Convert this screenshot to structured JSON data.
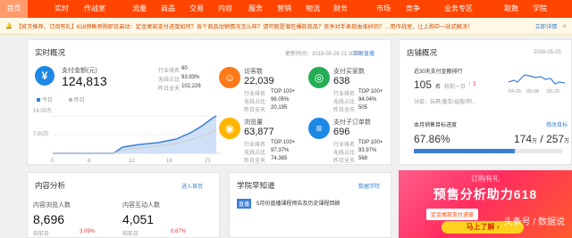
{
  "nav": {
    "items": [
      "首页",
      "实时",
      "作战室",
      "流量",
      "商品",
      "交易",
      "内容",
      "服务",
      "营销",
      "物流",
      "财务",
      "市场",
      "竞争",
      "业务专区",
      "取数",
      "学院"
    ],
    "active_index": 0
  },
  "notice": {
    "text": "【官方推荐，订阅有礼】618预售预购即日启动：定金尾款支付进度如何？各个商品动销情况怎么样？请可能是潜在爆款商品？竞争对手表现由谁好的？…用作战室，让上购中一站式解决！",
    "link_text": "立即详情",
    "close_icon": "×"
  },
  "realtime": {
    "title": "实时概况",
    "update_time": "更新时间：2018-05-26 21:30:05",
    "link": "实时直播",
    "payment_label": "支付金额(元)",
    "payment_value": "124,813",
    "rank_label": "行业排名",
    "rank_value": "60",
    "wireless_label": "无线占比",
    "wireless_value": "93.93%",
    "yesterday_label": "昨日全天",
    "yesterday_value": "102,226",
    "legend_today": "今日",
    "legend_yesterday": "昨日",
    "y_axis_top": "14.00万",
    "y_axis_mid": "7.00万",
    "x_axis": [
      "0",
      "6",
      "12",
      "18",
      "23"
    ],
    "cards": [
      {
        "label": "访客数",
        "value": "22,039",
        "rank_label": "行业排名",
        "rank": "TOP 100+",
        "wireless_label": "无线占比",
        "wireless": "96.05%",
        "yesterday_label": "昨日全天",
        "yesterday": "20,195",
        "icon": "user-icon",
        "color": "#ff7a1a"
      },
      {
        "label": "支付买家数",
        "value": "638",
        "rank_label": "行业排名",
        "rank": "TOP 100+",
        "wireless_label": "无线占比",
        "wireless": "94.04%",
        "yesterday_label": "昨日全天",
        "yesterday": "505",
        "icon": "buyer-icon",
        "color": "#23ad54"
      },
      {
        "label": "浏览量",
        "value": "63,877",
        "rank_label": "行业排名",
        "rank": "TOP 100+",
        "wireless_label": "无线占比",
        "wireless": "97.37%",
        "yesterday_label": "昨日全天",
        "yesterday": "74,385",
        "icon": "eye-icon",
        "color": "#ffb400"
      },
      {
        "label": "支付子订单数",
        "value": "696",
        "rank_label": "行业排名",
        "rank": "TOP 100+",
        "wireless_label": "无线占比",
        "wireless": "93.97%",
        "yesterday_label": "昨日全天",
        "yesterday": "568",
        "icon": "order-icon",
        "color": "#1e88e5"
      }
    ]
  },
  "store": {
    "title": "店铺概况",
    "date": "2018-05-25",
    "rank_title": "近30天支付金额排行",
    "rank_value": "105",
    "rank_unit": "名",
    "rank_change": "较前一日",
    "change_icon": "↑",
    "change_value": "3",
    "category": "分层：玩具/童车/益智/积...",
    "chart_dates": [
      "04-26",
      "05-08",
      "05-25"
    ],
    "target_title": "本月销售目标进度",
    "target_link": "修改目标",
    "progress": "67.86%",
    "progress_fraction": 0.6786,
    "amount_value": "174",
    "amount_unit": "万",
    "target_sep": "/",
    "target_value": "257",
    "target_unit": "万"
  },
  "content": {
    "title": "内容分析",
    "link": "进入首页",
    "browse_label": "内容浏览人数",
    "browse_value": "8,696",
    "interact_label": "内容互动人数",
    "interact_value": "4,051",
    "browse_compare": "较前日",
    "browse_delta": "3.09%",
    "interact_compare": "较前日",
    "interact_delta": "0.67%"
  },
  "academy": {
    "title": "学院早知道",
    "link": "数据学院",
    "badge": "直播",
    "item": "5月份直播课程预告及历史课程回顾"
  },
  "promo": {
    "cap": "订购有礼",
    "hero": "预售分析助力618",
    "pill": "定金尾款支付进度",
    "button": "马上了解 ›",
    "watermark": "头条号 / 数据说"
  }
}
